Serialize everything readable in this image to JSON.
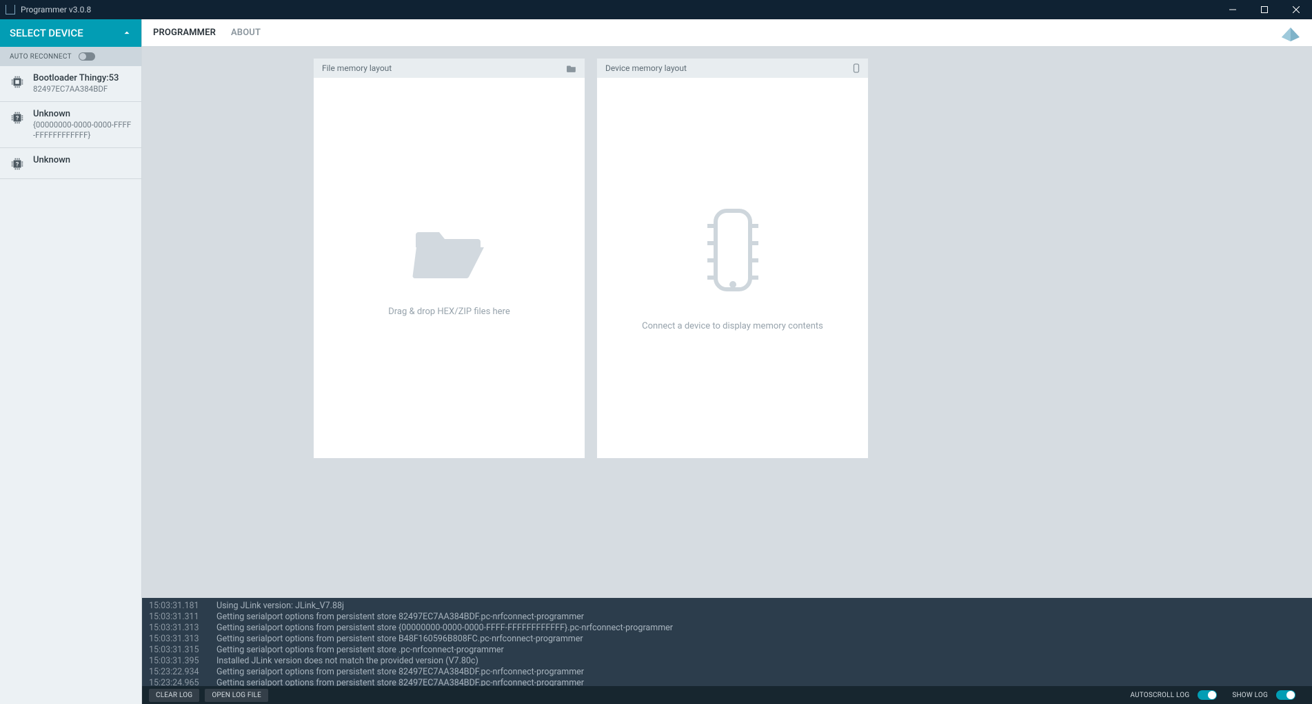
{
  "window": {
    "title": "Programmer v3.0.8"
  },
  "sidebar": {
    "select_device_label": "SELECT DEVICE",
    "auto_reconnect_label": "AUTO RECONNECT",
    "auto_reconnect_on": false,
    "devices": [
      {
        "name": "Bootloader Thingy:53",
        "sub": "82497EC7AA384BDF",
        "icon": "chip"
      },
      {
        "name": "Unknown",
        "sub": "{00000000-0000-0000-FFFF-FFFFFFFFFFFF}",
        "icon": "question"
      },
      {
        "name": "Unknown",
        "sub": "",
        "icon": "question"
      }
    ]
  },
  "tabs": {
    "programmer": "PROGRAMMER",
    "about": "ABOUT",
    "active": "programmer"
  },
  "panels": {
    "file": {
      "title": "File memory layout",
      "placeholder": "Drag & drop HEX/ZIP files here"
    },
    "device": {
      "title": "Device memory layout",
      "placeholder": "Connect a device to display memory contents"
    }
  },
  "log": {
    "entries": [
      {
        "t": "15:03:31.181",
        "m": "Using JLink version: JLink_V7.88j"
      },
      {
        "t": "15:03:31.311",
        "m": "Getting serialport options from persistent store 82497EC7AA384BDF.pc-nrfconnect-programmer"
      },
      {
        "t": "15:03:31.313",
        "m": "Getting serialport options from persistent store {00000000-0000-0000-FFFF-FFFFFFFFFFFF}.pc-nrfconnect-programmer"
      },
      {
        "t": "15:03:31.313",
        "m": "Getting serialport options from persistent store B48F160596B808FC.pc-nrfconnect-programmer"
      },
      {
        "t": "15:03:31.315",
        "m": "Getting serialport options from persistent store .pc-nrfconnect-programmer"
      },
      {
        "t": "15:03:31.395",
        "m": "Installed JLink version does not match the provided version (V7.80c)"
      },
      {
        "t": "15:23:22.934",
        "m": "Getting serialport options from persistent store 82497EC7AA384BDF.pc-nrfconnect-programmer"
      },
      {
        "t": "15:23:24.965",
        "m": "Getting serialport options from persistent store 82497EC7AA384BDF.pc-nrfconnect-programmer"
      }
    ],
    "clear_label": "CLEAR LOG",
    "open_label": "OPEN LOG FILE",
    "autoscroll_label": "AUTOSCROLL LOG",
    "autoscroll_on": true,
    "showlog_label": "SHOW LOG",
    "showlog_on": true
  }
}
